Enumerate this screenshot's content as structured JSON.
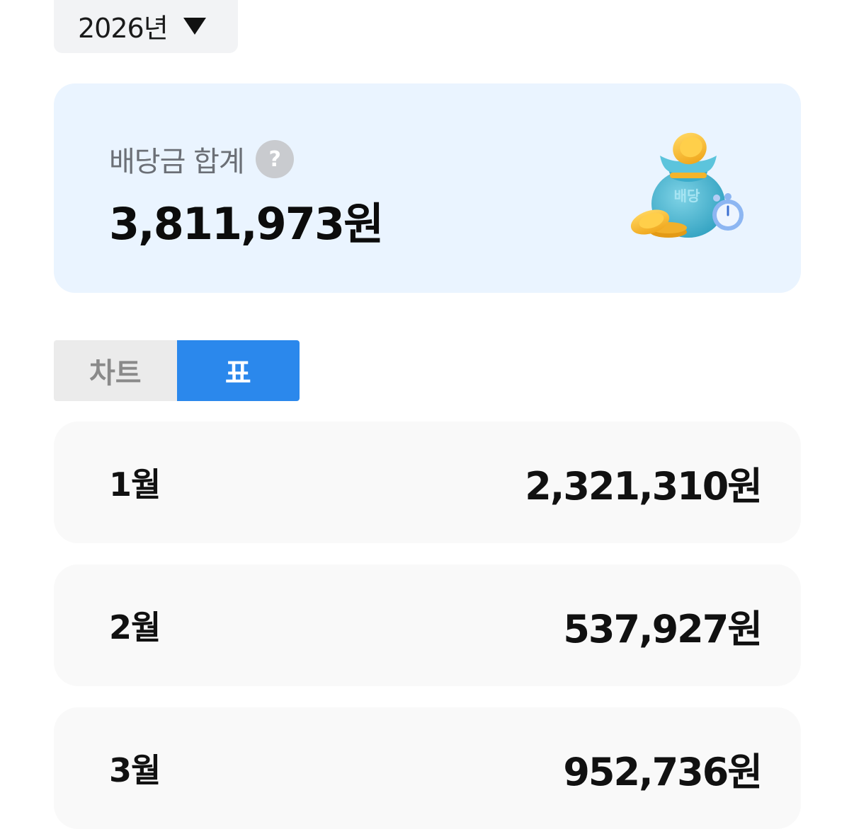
{
  "year_selector": {
    "label": "2026년",
    "caret_icon": "caret-down-icon"
  },
  "summary": {
    "label": "배당금 합계",
    "help_icon_glyph": "?",
    "amount": "3,811,973원",
    "illustration_text": "배당",
    "background_color": "#eaf4ff"
  },
  "view_toggle": {
    "options": [
      {
        "label": "차트",
        "selected": false
      },
      {
        "label": "표",
        "selected": true
      }
    ],
    "active_color": "#2b88ec"
  },
  "monthly": [
    {
      "month": "1월",
      "amount": "2,321,310원"
    },
    {
      "month": "2월",
      "amount": "537,927원"
    },
    {
      "month": "3월",
      "amount": "952,736원"
    }
  ]
}
